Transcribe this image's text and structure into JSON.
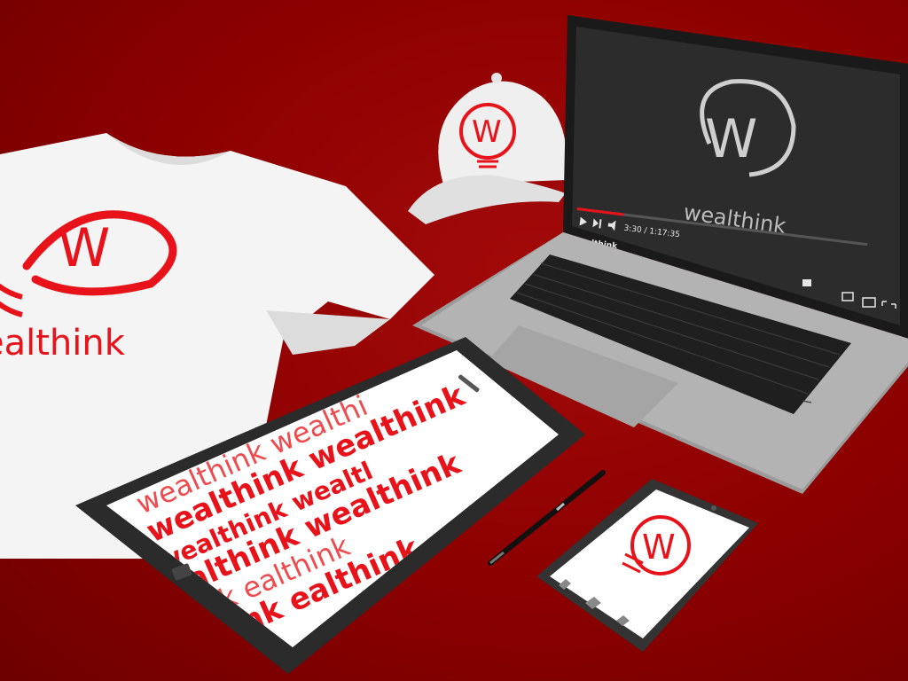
{
  "brand": {
    "name": "wealthink",
    "logo_letter": "W",
    "shirt_text": "ealthink",
    "colors": {
      "brand_red": "#e8131a",
      "background": "#8e0000",
      "screen_dark": "#2a2a2a"
    }
  },
  "laptop": {
    "video_title": "Wealthink",
    "video_time": "3:30 / 1:17:35",
    "progress": 0.16,
    "screen_logo_word": "wealthink"
  },
  "tablet": {
    "pattern_lines": [
      {
        "text": "wealthink wealthi",
        "style": "light"
      },
      {
        "text": "wealthink wealthink",
        "style": "bold"
      },
      {
        "text": "wealthink wealtl",
        "style": "mixed"
      },
      {
        "text": "ealthink wealthink",
        "style": "bold"
      },
      {
        "text": "hink ealthink",
        "style": "light"
      },
      {
        "text": "lthink ealthink",
        "style": "bold"
      }
    ]
  },
  "icons": [
    "play-icon",
    "skip-icon",
    "volume-icon",
    "settings-icon",
    "miniplayer-icon",
    "theater-icon",
    "fullscreen-icon",
    "back-icon",
    "home-icon",
    "recent-apps-icon"
  ]
}
